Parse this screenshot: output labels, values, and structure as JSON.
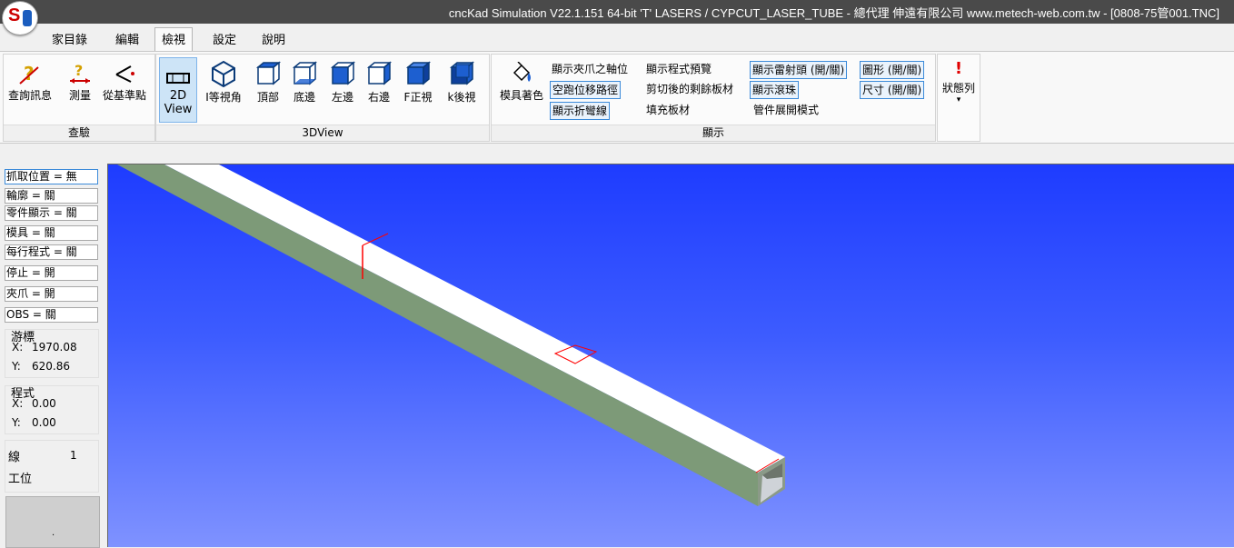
{
  "window": {
    "title": "cncKad Simulation V22.1.151 64-bit      'T' LASERS / CYPCUT_LASER_TUBE    - 總代理 伸遠有限公司 www.metech-web.com.tw - [0808-75管001.TNC]"
  },
  "tabs": [
    "家目錄",
    "編輯",
    "檢視",
    "設定",
    "說明"
  ],
  "ribbon": {
    "inspect": {
      "label": "查驗",
      "query": "查詢訊息",
      "measure": "測量",
      "from_ref": "從基準點"
    },
    "view3d": {
      "label": "3DView",
      "view2d_line1": "2D",
      "view2d_line2": "View",
      "iso": "I等視角",
      "top": "頂部",
      "bottom": "底邊",
      "left": "左邊",
      "right": "右邊",
      "front": "F正視",
      "back": "k後視"
    },
    "display": {
      "label": "顯示",
      "tool_color": "模具著色",
      "clamp_axis": "顯示夾爪之軸位",
      "rapid_path": "空跑位移路徑",
      "bend_lines": "顯示折彎線",
      "prog_preview": "顯示程式預覽",
      "remnant": "剪切後的剩餘板材",
      "fill": "填充板材",
      "laser_head": "顯示雷射頭 (開/關)",
      "beads": "顯示滾珠",
      "unfold": "管件展開模式",
      "graphic": "圖形 (開/關)",
      "dimension": "尺寸 (開/關)"
    },
    "status": {
      "label": "狀態列",
      "arrow": "▾"
    }
  },
  "left_panel": {
    "fields": [
      "抓取位置 = 無",
      "輪廓 = 關",
      "零件顯示 = 關",
      "模具 = 關",
      "每行程式 = 關",
      "停止 = 開",
      "夾爪 = 開",
      "OBS  = 關"
    ],
    "cursor": {
      "title": "游標",
      "x_label": "X:",
      "x": "1970.08",
      "y_label": "Y:",
      "y": "620.86"
    },
    "program": {
      "title": "程式",
      "x_label": "X:",
      "x": "0.00",
      "y_label": "Y:",
      "y": "0.00"
    },
    "line_label": "線",
    "line_value": "1",
    "station_label": "工位",
    "swatch_text": "."
  },
  "colors": {
    "viewport_top": "#1e3cff",
    "viewport_bottom": "#7f92ff",
    "tube_top": "#ffffff",
    "tube_side": "#7d9a78",
    "cut_line": "#ff0000",
    "accent": "#3b8ad9"
  }
}
